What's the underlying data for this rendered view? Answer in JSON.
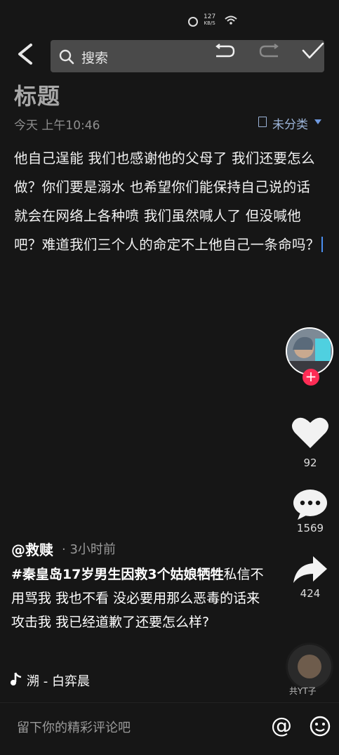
{
  "status_bar": {
    "net_speed_value": "127",
    "net_speed_unit": "KB/S"
  },
  "toolbar": {
    "search_label": "搜索"
  },
  "note": {
    "title": "标题",
    "date": "今天 上午10:46",
    "folder_label": "未分类",
    "body": "他自己逞能 我们也感谢他的父母了 我们还要怎么做？你们要是溺水 也希望你们能保持自己说的话 就会在网络上各种喷  我们虽然喊人了 但没喊他吧？难道我们三个人的命定不上他自己一条命吗？"
  },
  "right_rail": {
    "follow_symbol": "+",
    "like_count": "92",
    "comment_count": "1569",
    "share_count": "424",
    "disc_label": "共YT子"
  },
  "post": {
    "username": "@救赎",
    "time": "· 3小时前",
    "hashtag": "#秦皇岛17岁男生因救3个姑娘牺牲",
    "caption": "私信不用骂我 我也不看 没必要用那么恶毒的话来攻击我 我已经道歉了还要怎么样?",
    "music": "溯 - 白弈晨"
  },
  "comment_bar": {
    "placeholder": "留下你的精彩评论吧",
    "at_symbol": "@"
  },
  "colors": {
    "accent_blue": "#6f9ae0",
    "follow_red": "#fe2c55",
    "background": "#161616"
  }
}
